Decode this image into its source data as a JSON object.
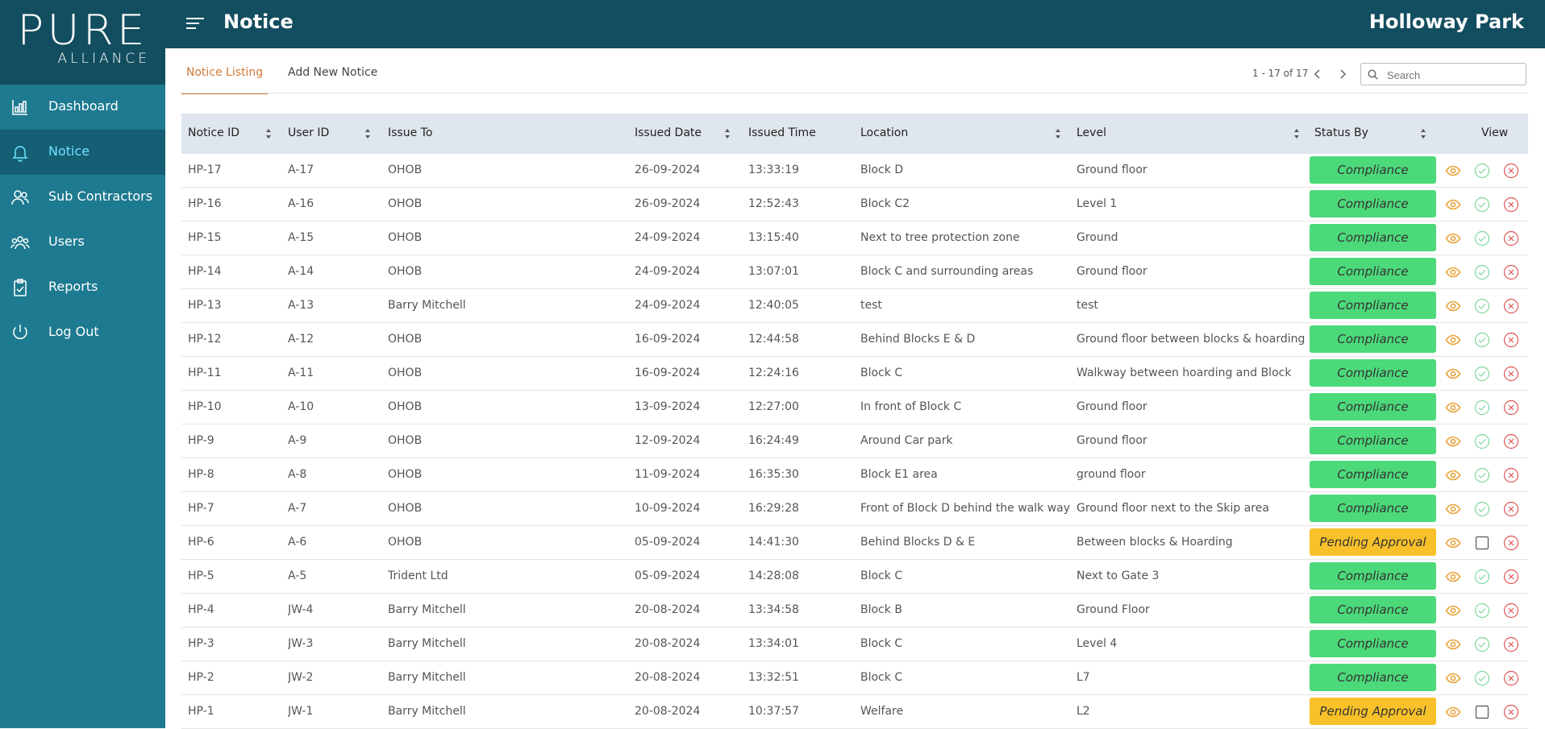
{
  "brand": {
    "logo_main": "PURE",
    "logo_sub": "ALLIANCE"
  },
  "header": {
    "title": "Notice",
    "site": "Holloway Park"
  },
  "sidebar": {
    "items": [
      {
        "label": "Dashboard",
        "icon": "dashboard-icon"
      },
      {
        "label": "Notice",
        "icon": "bell-icon",
        "active": true
      },
      {
        "label": "Sub Contractors",
        "icon": "contractors-icon"
      },
      {
        "label": "Users",
        "icon": "users-icon"
      },
      {
        "label": "Reports",
        "icon": "reports-icon"
      },
      {
        "label": "Log Out",
        "icon": "power-icon"
      }
    ]
  },
  "tabs": {
    "listing": "Notice Listing",
    "add": "Add New Notice"
  },
  "pager": {
    "text": "1 - 17 of 17"
  },
  "search": {
    "placeholder": "Search",
    "value": ""
  },
  "table": {
    "headers": {
      "notice_id": "Notice ID",
      "user_id": "User ID",
      "issue_to": "Issue To",
      "issued_date": "Issued Date",
      "issued_time": "Issued Time",
      "location": "Location",
      "level": "Level",
      "status_by": "Status By",
      "view": "View"
    },
    "rows": [
      [
        "HP-17",
        "A-17",
        "OHOB",
        "26-09-2024",
        "13:33:19",
        "Block D",
        "Ground floor",
        "Compliance"
      ],
      [
        "HP-16",
        "A-16",
        "OHOB",
        "26-09-2024",
        "12:52:43",
        "Block C2",
        "Level 1",
        "Compliance"
      ],
      [
        "HP-15",
        "A-15",
        "OHOB",
        "24-09-2024",
        "13:15:40",
        "Next to tree protection zone",
        "Ground",
        "Compliance"
      ],
      [
        "HP-14",
        "A-14",
        "OHOB",
        "24-09-2024",
        "13:07:01",
        "Block C and surrounding areas",
        "Ground floor",
        "Compliance"
      ],
      [
        "HP-13",
        "A-13",
        "Barry Mitchell",
        "24-09-2024",
        "12:40:05",
        "test",
        "test",
        "Compliance"
      ],
      [
        "HP-12",
        "A-12",
        "OHOB",
        "16-09-2024",
        "12:44:58",
        "Behind Blocks E & D",
        "Ground floor between blocks & hoarding",
        "Compliance"
      ],
      [
        "HP-11",
        "A-11",
        "OHOB",
        "16-09-2024",
        "12:24:16",
        "Block C",
        "Walkway between hoarding and Block",
        "Compliance"
      ],
      [
        "HP-10",
        "A-10",
        "OHOB",
        "13-09-2024",
        "12:27:00",
        "In front of Block C",
        "Ground floor",
        "Compliance"
      ],
      [
        "HP-9",
        "A-9",
        "OHOB",
        "12-09-2024",
        "16:24:49",
        "Around Car park",
        "Ground floor",
        "Compliance"
      ],
      [
        "HP-8",
        "A-8",
        "OHOB",
        "11-09-2024",
        "16:35:30",
        "Block E1 area",
        "ground floor",
        "Compliance"
      ],
      [
        "HP-7",
        "A-7",
        "OHOB",
        "10-09-2024",
        "16:29:28",
        "Front of Block D behind the walk way",
        "Ground floor next to the Skip area",
        "Compliance"
      ],
      [
        "HP-6",
        "A-6",
        "OHOB",
        "05-09-2024",
        "14:41:30",
        "Behind Blocks D & E",
        "Between blocks & Hoarding",
        "Pending Approval"
      ],
      [
        "HP-5",
        "A-5",
        "Trident Ltd",
        "05-09-2024",
        "14:28:08",
        "Block C",
        "Next to Gate 3",
        "Compliance"
      ],
      [
        "HP-4",
        "JW-4",
        "Barry Mitchell",
        "20-08-2024",
        "13:34:58",
        "Block B",
        "Ground Floor",
        "Compliance"
      ],
      [
        "HP-3",
        "JW-3",
        "Barry Mitchell",
        "20-08-2024",
        "13:34:01",
        "Block C",
        "Level 4",
        "Compliance"
      ],
      [
        "HP-2",
        "JW-2",
        "Barry Mitchell",
        "20-08-2024",
        "13:32:51",
        "Block C",
        "L7",
        "Compliance"
      ],
      [
        "HP-1",
        "JW-1",
        "Barry Mitchell",
        "20-08-2024",
        "10:37:57",
        "Welfare",
        "L2",
        "Pending Approval"
      ]
    ]
  },
  "colors": {
    "sidebar": "#1e7a90",
    "header": "#134e60",
    "active_tab": "#d27a3a",
    "compliance": "#4cd97a",
    "pending": "#f8c12a",
    "eye": "#e8a33a",
    "check": "#7fd69a",
    "reject": "#e05555"
  },
  "action_icons": [
    "eye-icon",
    "check-circle-icon",
    "close-circle-icon",
    "checkbox"
  ]
}
